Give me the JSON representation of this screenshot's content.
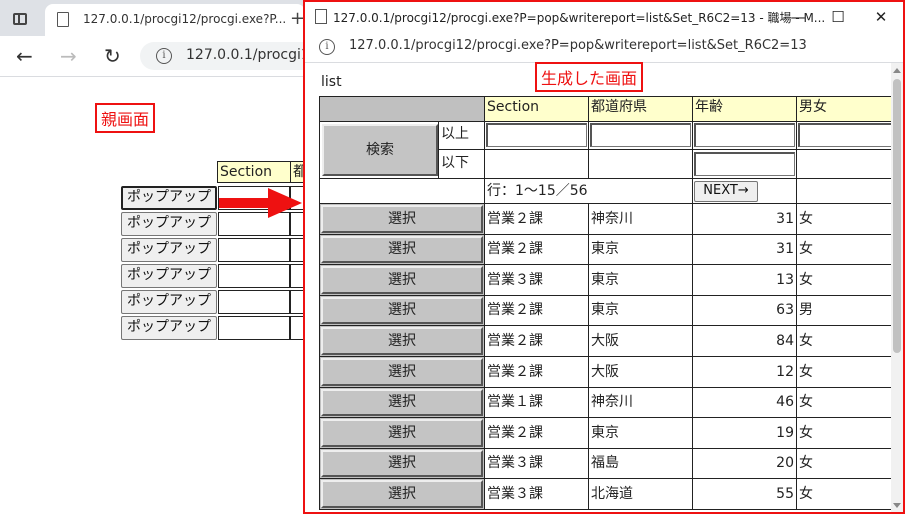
{
  "parent": {
    "tab_title": "127.0.0.1/procgi12/procgi.exe?P...",
    "url": "127.0.0.1/procgi12/",
    "annotation": "親画面",
    "header_cells": [
      "Section",
      "都"
    ],
    "popup_button_label": "ポップアップ",
    "popup_buttons": 6
  },
  "popup": {
    "title": "127.0.0.1/procgi12/procgi.exe?P=pop&writereport=list&Set_R6C2=13 - 職場 - M...",
    "url": "127.0.0.1/procgi12/procgi.exe?P=pop&writereport=list&Set_R6C2=13",
    "annotation": "生成した画面",
    "list_label": "list",
    "columns": [
      "Section",
      "都道府県",
      "年齢",
      "男女"
    ],
    "search_button": "検索",
    "gte_label": "以上",
    "lte_label": "以下",
    "row_info": "行：1～15／56",
    "next_button": "NEXT→",
    "select_label": "選択",
    "rows": [
      {
        "section": "営業２課",
        "pref": "神奈川",
        "age": "31",
        "gender": "女"
      },
      {
        "section": "営業２課",
        "pref": "東京",
        "age": "31",
        "gender": "女"
      },
      {
        "section": "営業３課",
        "pref": "東京",
        "age": "13",
        "gender": "女"
      },
      {
        "section": "営業２課",
        "pref": "東京",
        "age": "63",
        "gender": "男"
      },
      {
        "section": "営業２課",
        "pref": "大阪",
        "age": "84",
        "gender": "女"
      },
      {
        "section": "営業２課",
        "pref": "大阪",
        "age": "12",
        "gender": "女"
      },
      {
        "section": "営業１課",
        "pref": "神奈川",
        "age": "46",
        "gender": "女"
      },
      {
        "section": "営業２課",
        "pref": "東京",
        "age": "19",
        "gender": "女"
      },
      {
        "section": "営業３課",
        "pref": "福島",
        "age": "20",
        "gender": "女"
      },
      {
        "section": "営業３課",
        "pref": "北海道",
        "age": "55",
        "gender": "女"
      }
    ]
  },
  "icons": {
    "window_menu": "window-menu-icon",
    "page": "document-icon",
    "info": "info-icon",
    "back": "back-arrow-icon",
    "forward": "forward-arrow-icon",
    "reload": "reload-icon",
    "minimize": "minimize-icon",
    "maximize": "maximize-icon",
    "close": "close-icon"
  },
  "colors": {
    "annotation": "#e11111",
    "header_bg": "#ffffcc",
    "gray_header": "#c0c0c0"
  }
}
